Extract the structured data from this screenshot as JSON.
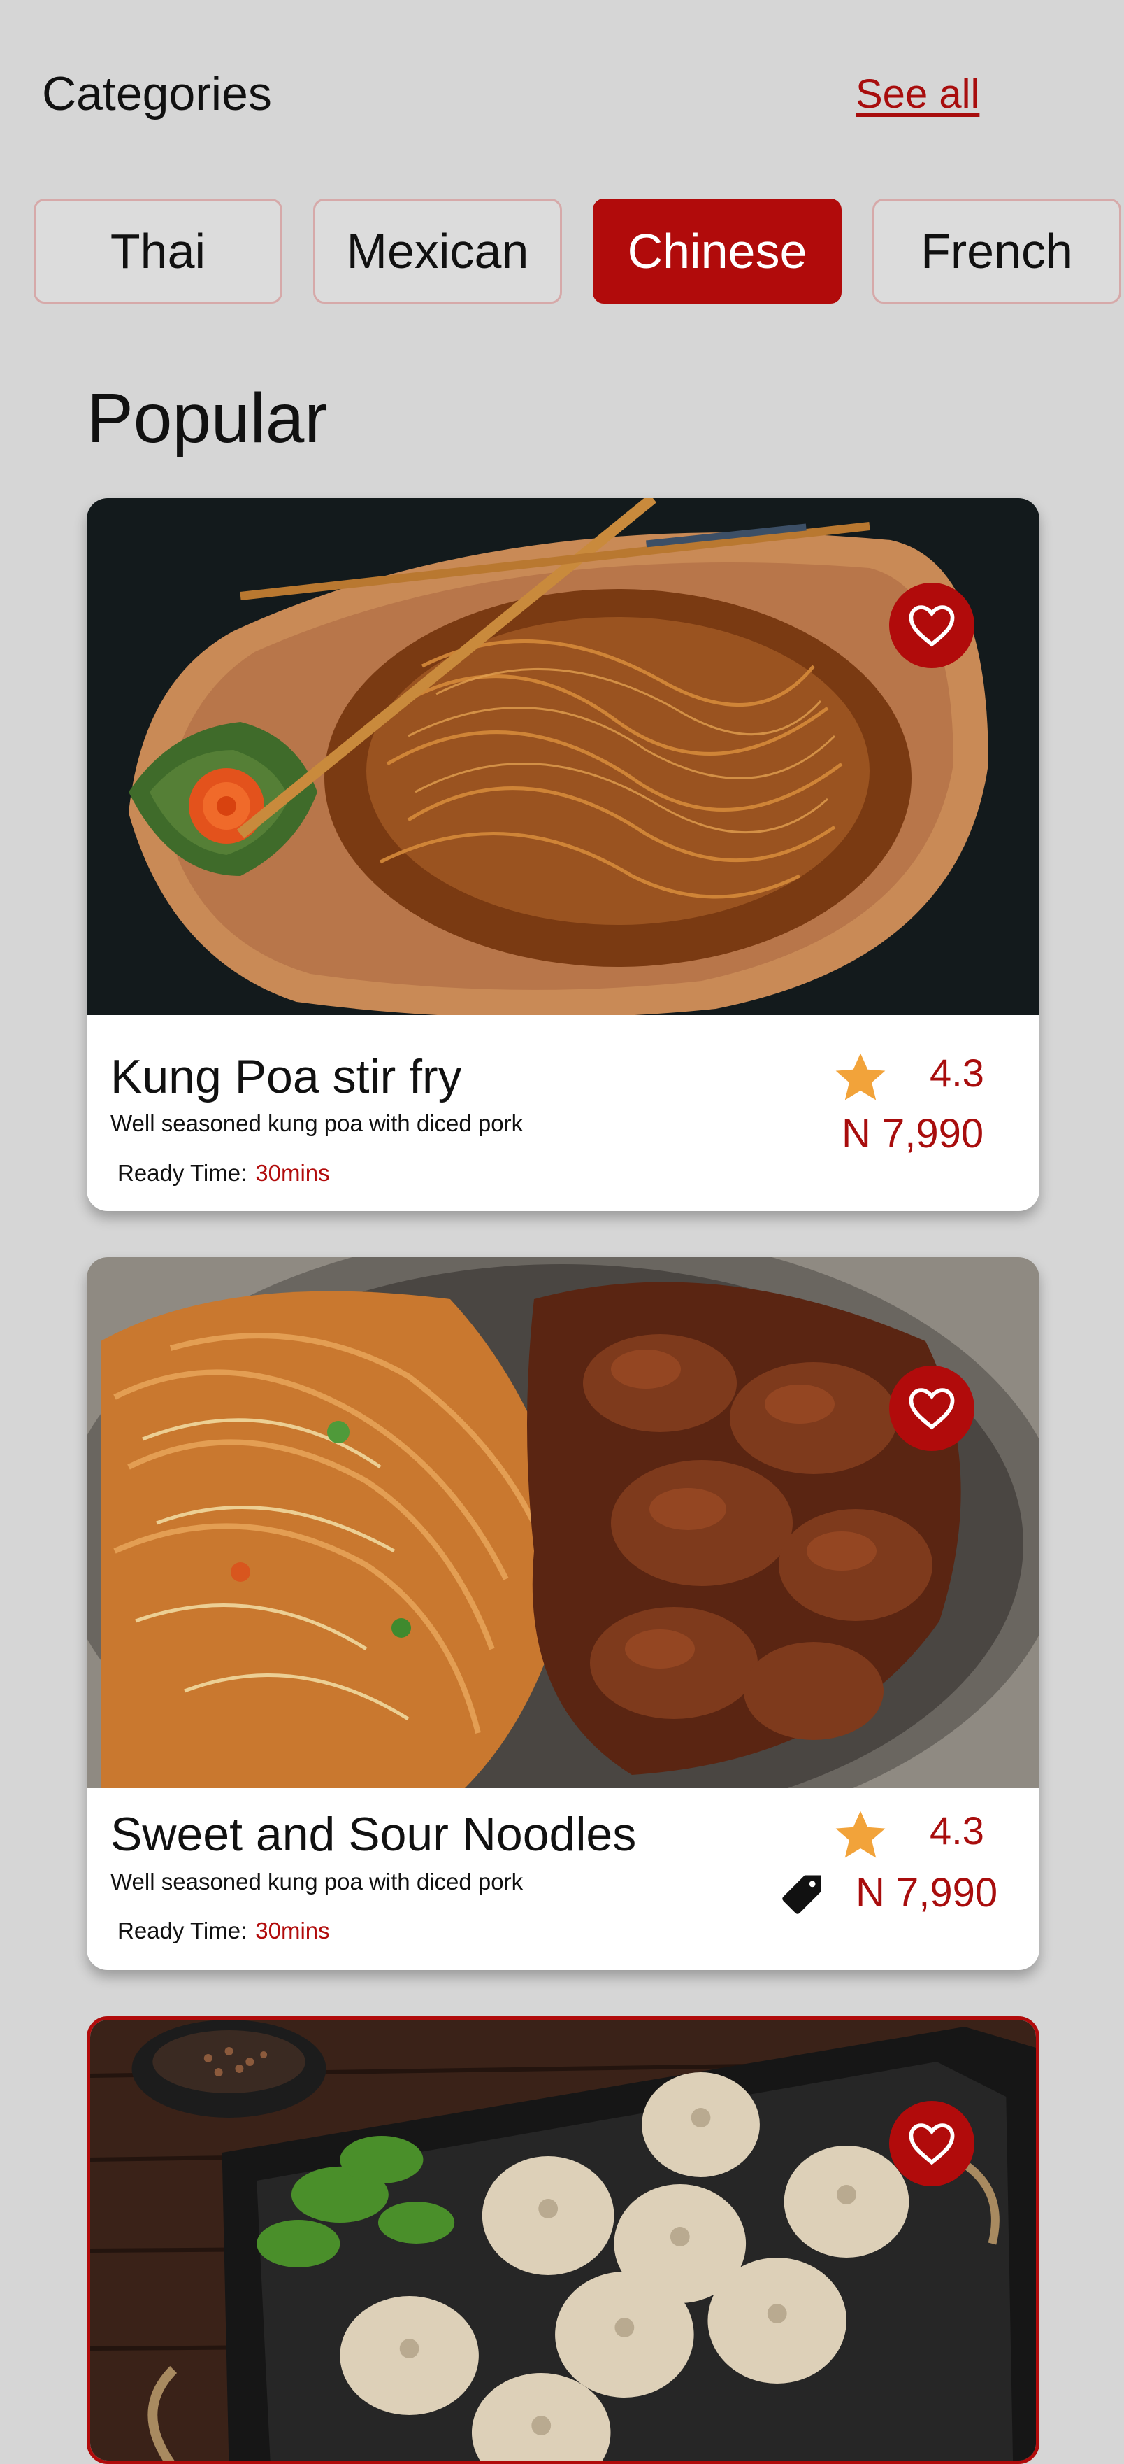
{
  "header": {
    "categories_title": "Categories",
    "see_all_label": "See all"
  },
  "categories": [
    {
      "label": "Thai",
      "active": false
    },
    {
      "label": "Mexican",
      "active": false
    },
    {
      "label": "Chinese",
      "active": true
    },
    {
      "label": "French",
      "active": false
    }
  ],
  "popular_title": "Popular",
  "dishes": [
    {
      "name": "Kung Poa stir fry",
      "description": "Well seasoned kung poa with diced pork",
      "ready_label": "Ready Time:",
      "ready_time": "30mins",
      "rating": "4.3",
      "price": "N 7,990",
      "image": "chow-mein-noodles-photo",
      "favorite_icon": "heart-icon"
    },
    {
      "name": "Sweet and Sour Noodles",
      "description": "Well seasoned kung poa with diced pork",
      "ready_label": "Ready Time:",
      "ready_time": "30mins",
      "rating": "4.3",
      "price": "N 7,990",
      "image": "noodles-and-sweet-sour-pork-photo",
      "favorite_icon": "heart-icon",
      "price_icon": "price-tag-icon"
    },
    {
      "image": "dumplings-tray-photo",
      "favorite_icon": "heart-icon"
    }
  ],
  "colors": {
    "accent": "#b10b0b",
    "background": "#d6d6d6",
    "star": "#f2a33a",
    "card": "#ffffff"
  }
}
